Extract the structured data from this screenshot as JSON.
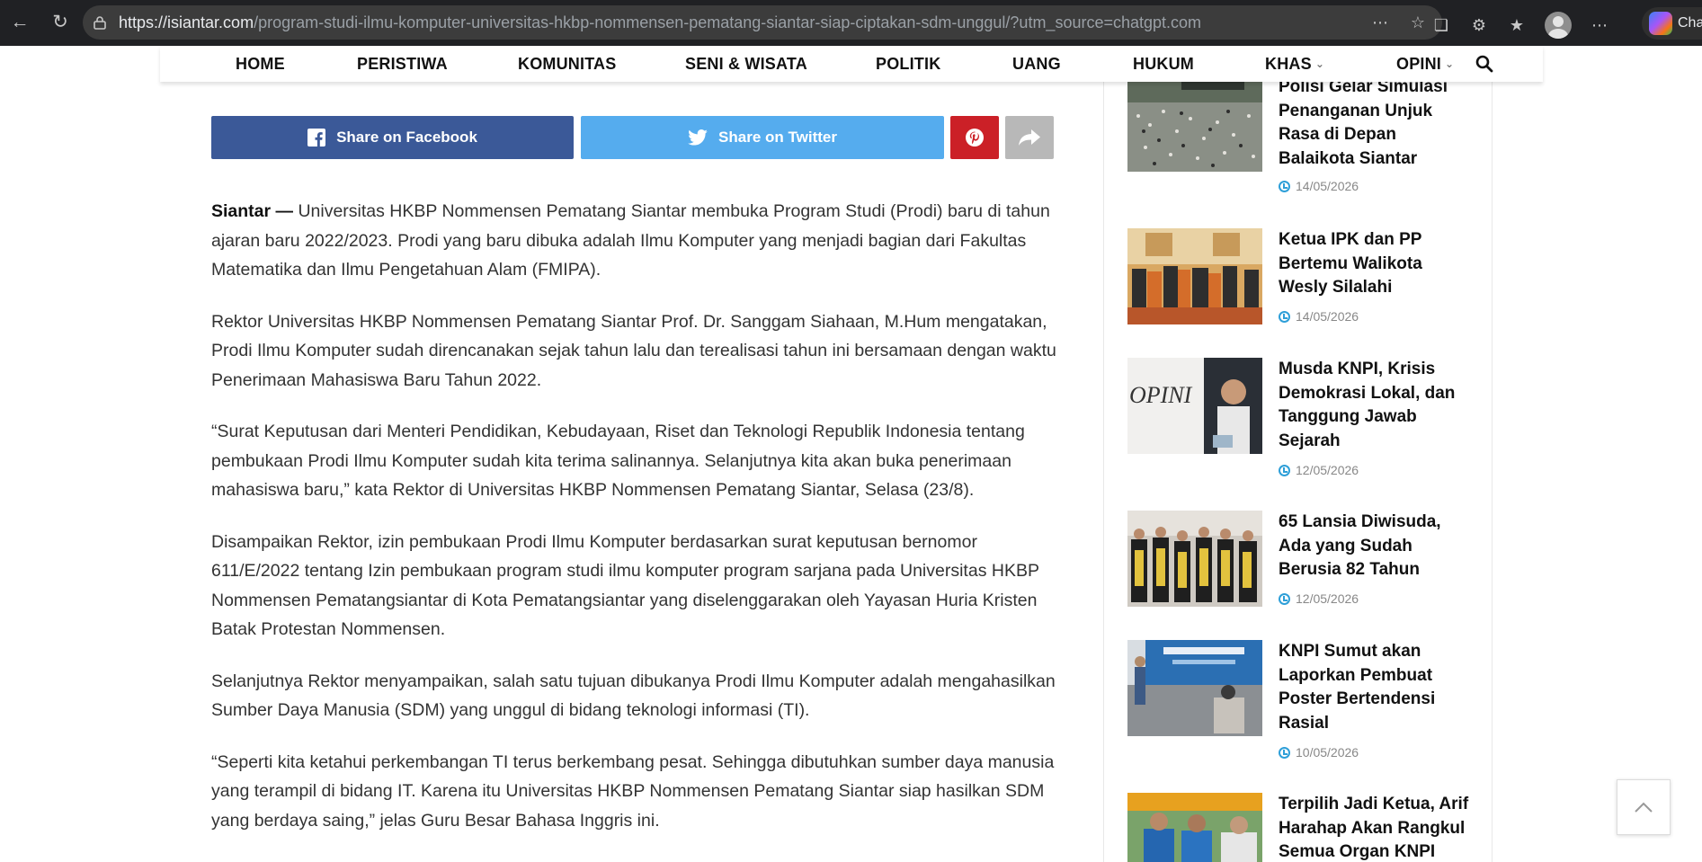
{
  "browser": {
    "url_host": "https://isiantar.com",
    "url_path": "/program-studi-ilmu-komputer-universitas-hkbp-nommensen-pematang-siantar-siap-ciptakan-sdm-unggul/?utm_source=chatgpt.com",
    "copilot_label": "Cha"
  },
  "nav": {
    "items": [
      "HOME",
      "PERISTIWA",
      "KOMUNITAS",
      "SENI & WISATA",
      "POLITIK",
      "UANG",
      "HUKUM",
      "KHAS",
      "OPINI"
    ]
  },
  "share": {
    "facebook": "Share on Facebook",
    "twitter": "Share on Twitter"
  },
  "article": {
    "lead": "Siantar —",
    "p1": " Universitas HKBP Nommensen Pematang Siantar membuka Program Studi (Prodi) baru di tahun ajaran baru 2022/2023. Prodi yang baru dibuka adalah Ilmu Komputer yang menjadi bagian dari Fakultas Matematika dan Ilmu Pengetahuan Alam (FMIPA).",
    "p2": "Rektor Universitas HKBP Nommensen Pematang Siantar Prof. Dr. Sanggam Siahaan, M.Hum mengatakan, Prodi Ilmu Komputer sudah direncanakan sejak tahun lalu dan terealisasi tahun ini bersamaan dengan waktu Penerimaan Mahasiswa Baru Tahun 2022.",
    "p3": "“Surat Keputusan dari Menteri Pendidikan, Kebudayaan, Riset dan Teknologi Republik Indonesia tentang pembukaan Prodi Ilmu Komputer sudah kita terima salinannya. Selanjutnya kita akan buka penerimaan mahasiswa baru,” kata Rektor di Universitas HKBP Nommensen Pematang Siantar, Selasa (23/8).",
    "p4": "Disampaikan Rektor, izin pembukaan Prodi Ilmu Komputer berdasarkan surat keputusan bernomor 611/E/2022 tentang Izin pembukaan program studi ilmu komputer program sarjana pada Universitas HKBP Nommensen Pematangsiantar di Kota Pematangsiantar yang diselenggarakan oleh Yayasan Huria Kristen Batak Protestan Nommensen.",
    "p5": "Selanjutnya Rektor  menyampaikan, salah satu tujuan dibukanya Prodi Ilmu Komputer adalah mengahasilkan Sumber Daya Manusia (SDM) yang unggul di bidang teknologi informasi (TI).",
    "p6": "“Seperti kita ketahui perkembangan TI terus berkembang pesat. Sehingga dibutuhkan sumber daya manusia yang terampil di bidang IT. Karena itu Universitas HKBP Nommensen Pematang Siantar siap hasilkan SDM yang berdaya saing,” jelas Guru Besar Bahasa Inggris ini."
  },
  "sidebar": {
    "posts": [
      {
        "title": "Polisi Gelar Simulasi Penanganan Unjuk Rasa di Depan Balaikota Siantar",
        "date": "14/05/2026"
      },
      {
        "title": "Ketua IPK dan PP Bertemu Walikota Wesly Silalahi",
        "date": "14/05/2026"
      },
      {
        "title": "Musda KNPI, Krisis Demokrasi Lokal, dan Tanggung Jawab Sejarah",
        "date": "12/05/2026",
        "thumb_text": "OPINI"
      },
      {
        "title": "65 Lansia Diwisuda, Ada yang Sudah Berusia 82 Tahun",
        "date": "12/05/2026"
      },
      {
        "title": "KNPI Sumut akan Laporkan Pembuat Poster Bertendensi Rasial",
        "date": "10/05/2026"
      },
      {
        "title": "Terpilih Jadi Ketua, Arif Harahap Akan Rangkul Semua Organ KNPI",
        "date": ""
      }
    ]
  },
  "colors": {
    "facebook": "#3b5998",
    "twitter": "#55acee",
    "pinterest": "#cb2027",
    "date_icon": "#2e9fd8"
  }
}
